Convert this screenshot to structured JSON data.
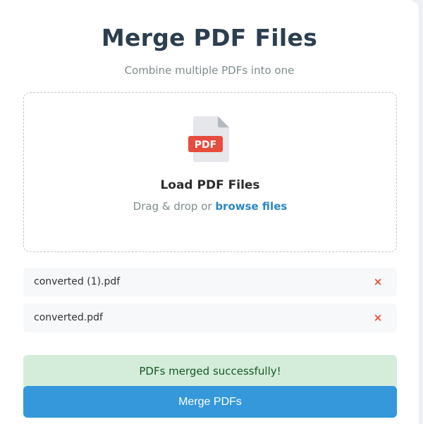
{
  "header": {
    "title": "Merge PDF Files",
    "subtitle": "Combine multiple PDFs into one"
  },
  "dropzone": {
    "icon": "pdf-file-icon",
    "icon_badge": "PDF",
    "title": "Load PDF Files",
    "hint_prefix": "Drag & drop or ",
    "browse_link": "browse files"
  },
  "files": [
    {
      "name": "converted (1).pdf",
      "remove_label": "×"
    },
    {
      "name": "converted.pdf",
      "remove_label": "×"
    }
  ],
  "status": {
    "message": "PDFs merged successfully!",
    "type": "success"
  },
  "actions": {
    "merge_label": "Merge PDFs"
  },
  "colors": {
    "accent": "#3498db",
    "title": "#2c3e50",
    "link": "#2e86c1",
    "remove": "#e74c3c",
    "success_bg": "#d4edda",
    "success_text": "#155724",
    "pdf_badge": "#e74c3c"
  }
}
